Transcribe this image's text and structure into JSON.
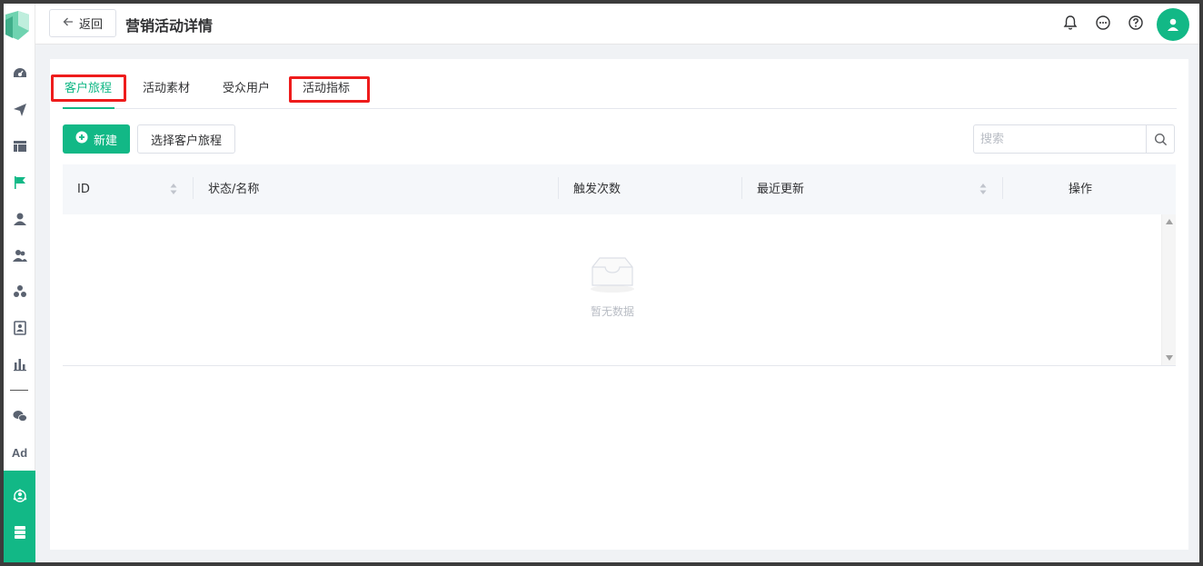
{
  "header": {
    "back_label": "返回",
    "title": "营销活动详情"
  },
  "tabs": [
    {
      "label": "客户旅程",
      "active": true
    },
    {
      "label": "活动素材",
      "active": false
    },
    {
      "label": "受众用户",
      "active": false
    },
    {
      "label": "活动指标",
      "active": false
    }
  ],
  "toolbar": {
    "new_label": "新建",
    "select_label": "选择客户旅程",
    "search_placeholder": "搜索"
  },
  "table": {
    "columns": [
      "ID",
      "状态/名称",
      "触发次数",
      "最近更新",
      "操作"
    ],
    "empty_text": "暂无数据"
  },
  "sidebar": {
    "items": [
      "dashboard-icon",
      "send-icon",
      "layout-icon",
      "flag-icon",
      "user-icon",
      "users-icon",
      "cluster-icon",
      "badge-icon",
      "bar-chart-icon",
      "wechat-icon",
      "Ad",
      "journey-icon",
      "server-icon"
    ],
    "ad_label": "Ad"
  },
  "colors": {
    "accent": "#12b886",
    "highlight": "#ee1c1c"
  }
}
